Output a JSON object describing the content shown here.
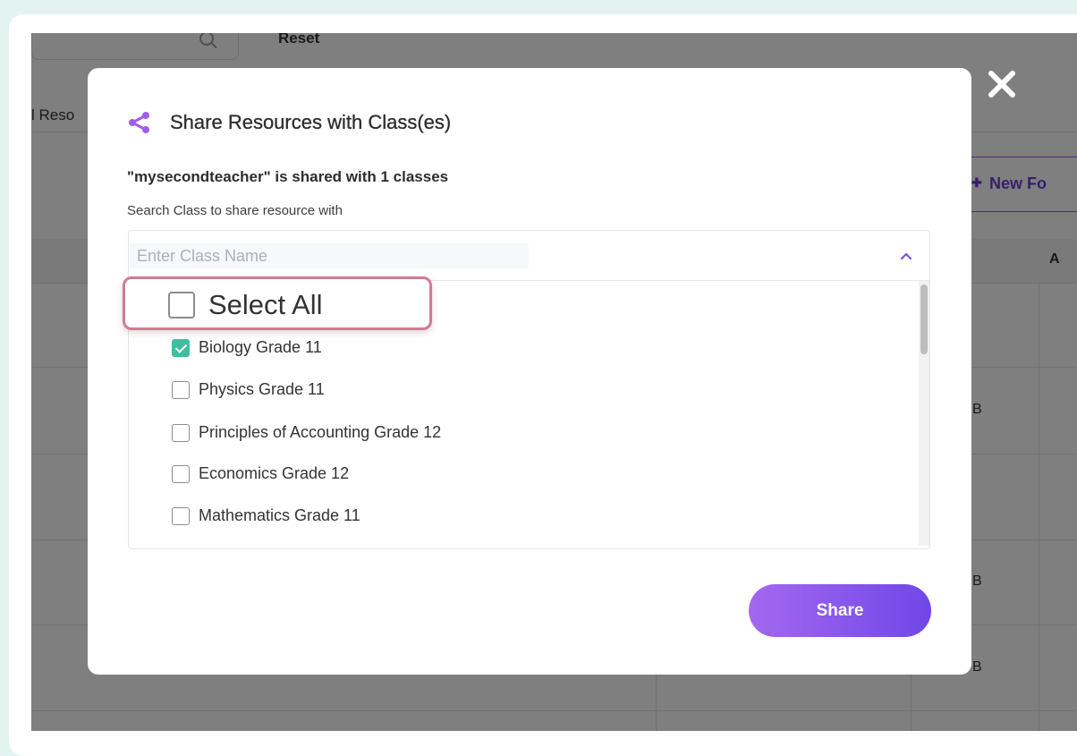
{
  "background": {
    "reset_label": "Reset",
    "tab_label": "l Reso",
    "new_folder_label": "New Fo",
    "header_col_label": "A",
    "cell_b1": "B",
    "cell_b2": "B",
    "cell_b3": "B"
  },
  "modal": {
    "title": "Share Resources with Class(es)",
    "shared_info": "\"mysecondteacher\" is shared with 1 classes",
    "search_label": "Search Class to share resource with",
    "search_placeholder": "Enter Class Name",
    "search_value": "",
    "select_all_label": "Select All",
    "classes": [
      {
        "label": "Biology Grade 11",
        "checked": true
      },
      {
        "label": "Physics Grade 11",
        "checked": false
      },
      {
        "label": "Principles of Accounting Grade 12",
        "checked": false
      },
      {
        "label": "Economics Grade 12",
        "checked": false
      },
      {
        "label": "Mathematics Grade 11",
        "checked": false
      }
    ],
    "share_button_label": "Share"
  },
  "icons": {
    "share": "share-icon",
    "close": "close-icon",
    "chevron": "chevron-up-icon",
    "search": "search-icon",
    "folder": "folder-icon"
  },
  "colors": {
    "accent_purple": "#8a5cf0",
    "checkbox_checked": "#3fbf9f",
    "highlight_border": "#d37a92",
    "page_background": "#e3f3ef"
  }
}
